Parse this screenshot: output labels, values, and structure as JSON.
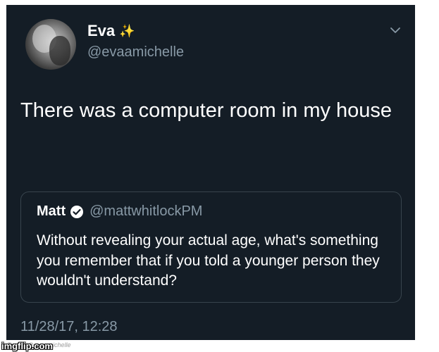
{
  "author": {
    "name": "Eva",
    "emoji": "✨",
    "handle": "@evaamichelle"
  },
  "tweet": {
    "text": "There was a computer room in my house",
    "timestamp": "11/28/17, 12:28"
  },
  "quoted": {
    "name": "Matt",
    "handle": "@mattwhitlockPM",
    "text": "Without revealing your actual age, what's something you remember that if you told a younger person they wouldn't understand?"
  },
  "footer": {
    "credit": "Twitter/@evaamichelle",
    "watermark": "imgflip.com"
  },
  "colors": {
    "background": "#141d26",
    "secondary_text": "#8899a6",
    "verified": "#ffffff",
    "sparkle": "#f4c542"
  },
  "icons": [
    "chevron-down-icon",
    "verified-icon",
    "sparkle-icon"
  ]
}
